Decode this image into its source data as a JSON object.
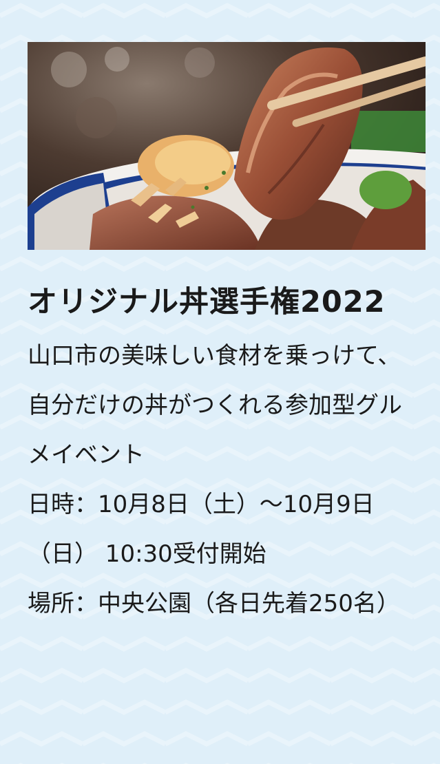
{
  "event": {
    "image_alt": "焼肉丼の写真",
    "title": "オリジナル丼選手権2022",
    "description": "山口市の美味しい食材を乗っけて、自分だけの丼がつくれる参加型グルメイベント",
    "datetime": "日時：10月8日（土）〜10月9日（日） 10:30受付開始",
    "location": "場所：中央公園（各日先着250名）"
  },
  "colors": {
    "background": "#dfeff9",
    "text": "#1a1a1a",
    "bowl_rim": "#1d3f8f"
  }
}
